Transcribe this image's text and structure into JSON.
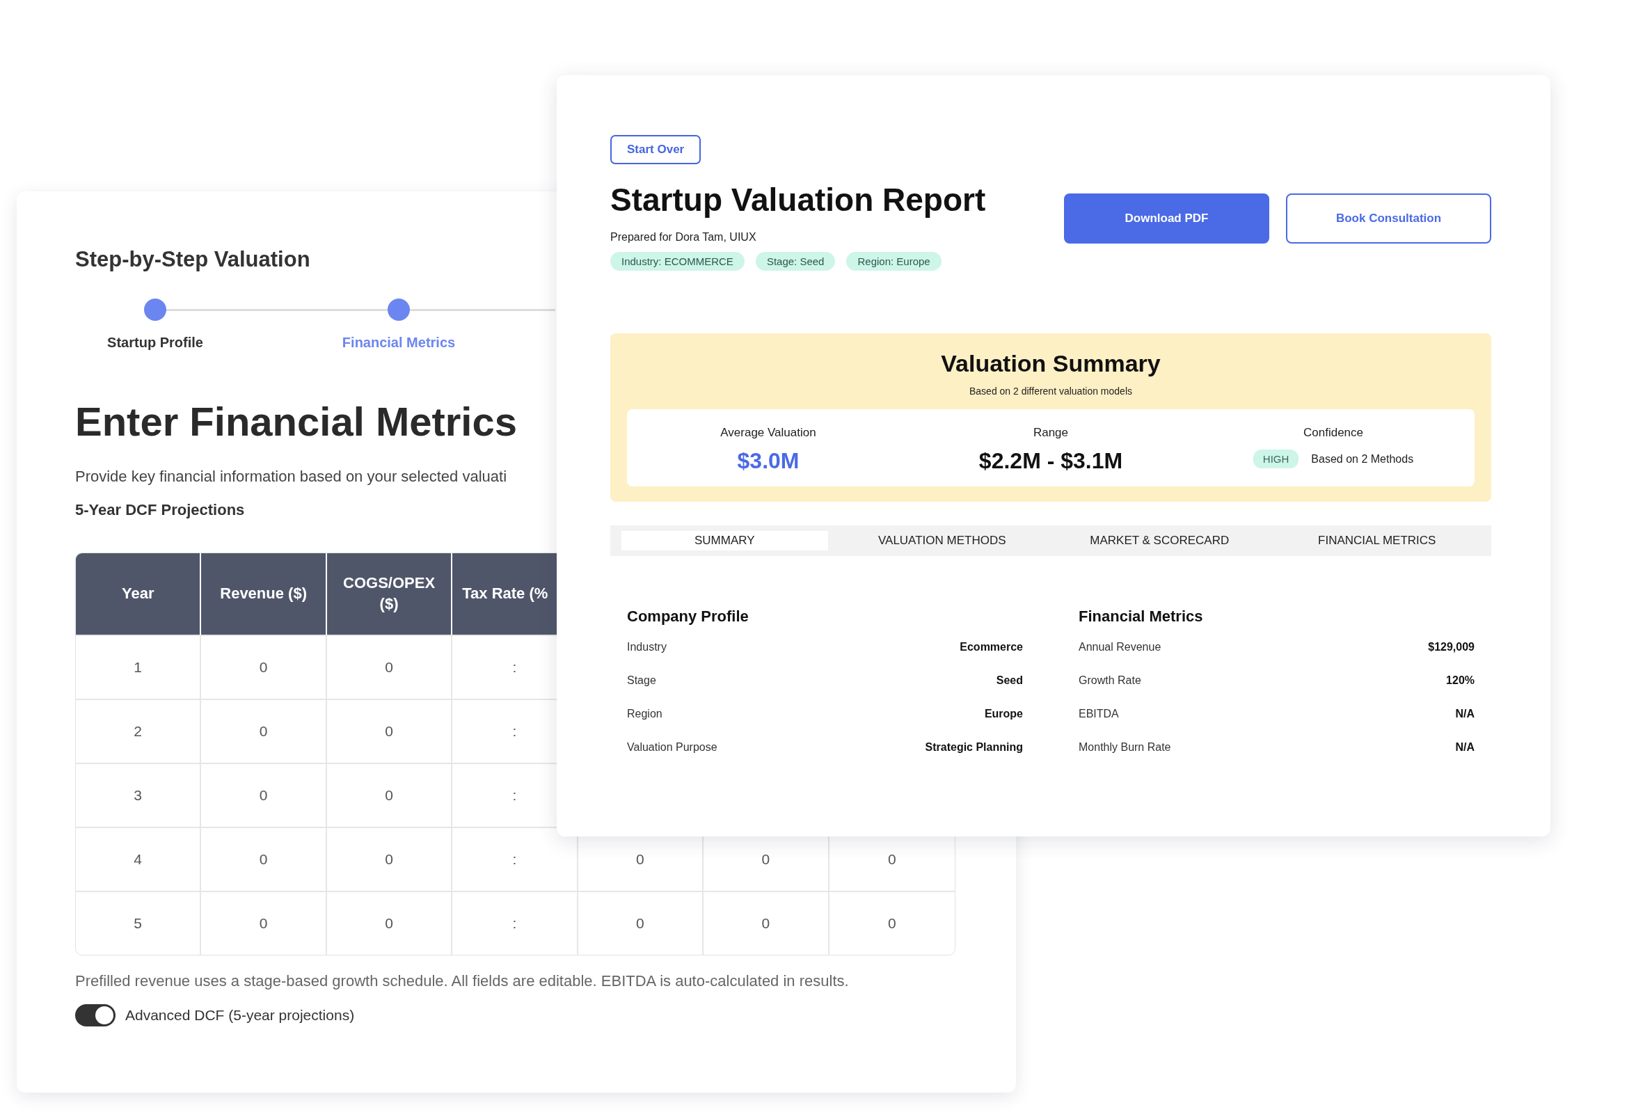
{
  "wizard": {
    "title": "Step-by-Step Valuation",
    "steps": [
      {
        "label": "Startup Profile",
        "selected": false
      },
      {
        "label": "Financial Metrics",
        "selected": true
      }
    ],
    "heading": "Enter Financial Metrics",
    "description": "Provide key financial information based on your selected valuati",
    "table_title": "5-Year DCF Projections",
    "table": {
      "columns": [
        "Year",
        "Revenue ($)",
        "COGS/OPEX ($)",
        "Tax Rate (%"
      ],
      "rows": [
        [
          "1",
          "0",
          "0",
          ":"
        ],
        [
          "2",
          "0",
          "0",
          ":"
        ],
        [
          "3",
          "0",
          "0",
          ":"
        ],
        [
          "4",
          "0",
          "0",
          ":",
          "0",
          "0",
          "0"
        ],
        [
          "5",
          "0",
          "0",
          ":",
          "0",
          "0",
          "0"
        ]
      ]
    },
    "note": "Prefilled revenue uses a stage-based growth schedule. All fields are editable. EBITDA is auto-calculated in results.",
    "toggle": {
      "label": "Advanced DCF (5-year projections)",
      "on": true
    }
  },
  "report": {
    "start_over": "Start Over",
    "title": "Startup Valuation Report",
    "prepared_for": "Prepared for Dora Tam, UIUX",
    "tags": [
      "Industry: ECOMMERCE",
      "Stage: Seed",
      "Region: Europe"
    ],
    "buttons": [
      {
        "label": "Download PDF",
        "kind": "primary"
      },
      {
        "label": "Book Consultation",
        "kind": "outline"
      }
    ],
    "summary": {
      "title": "Valuation Summary",
      "subtitle": "Based on 2 different valuation models",
      "stats": [
        {
          "kind": "value",
          "label": "Average Valuation",
          "value": "$3.0M"
        },
        {
          "kind": "range",
          "label": "Range",
          "value": "$2.2M - $3.1M"
        },
        {
          "kind": "badge",
          "label": "Confidence",
          "badge": "HIGH",
          "note": "Based on 2 Methods"
        }
      ]
    },
    "tabs": [
      {
        "label": "SUMMARY",
        "selected": true
      },
      {
        "label": "VALUATION METHODS",
        "selected": false
      },
      {
        "label": "MARKET & SCORECARD",
        "selected": false
      },
      {
        "label": "FINANCIAL METRICS",
        "selected": false
      }
    ],
    "sections": [
      {
        "title": "Company Profile",
        "rows": [
          {
            "label": "Industry",
            "value": "Ecommerce"
          },
          {
            "label": "Stage",
            "value": "Seed"
          },
          {
            "label": "Region",
            "value": "Europe"
          },
          {
            "label": "Valuation Purpose",
            "value": "Strategic Planning"
          }
        ]
      },
      {
        "title": "Financial Metrics",
        "rows": [
          {
            "label": "Annual Revenue",
            "value": "$129,009"
          },
          {
            "label": "Growth Rate",
            "value": "120%"
          },
          {
            "label": "EBITDA",
            "value": "N/A"
          },
          {
            "label": "Monthly Burn Rate",
            "value": "N/A"
          }
        ]
      }
    ]
  }
}
